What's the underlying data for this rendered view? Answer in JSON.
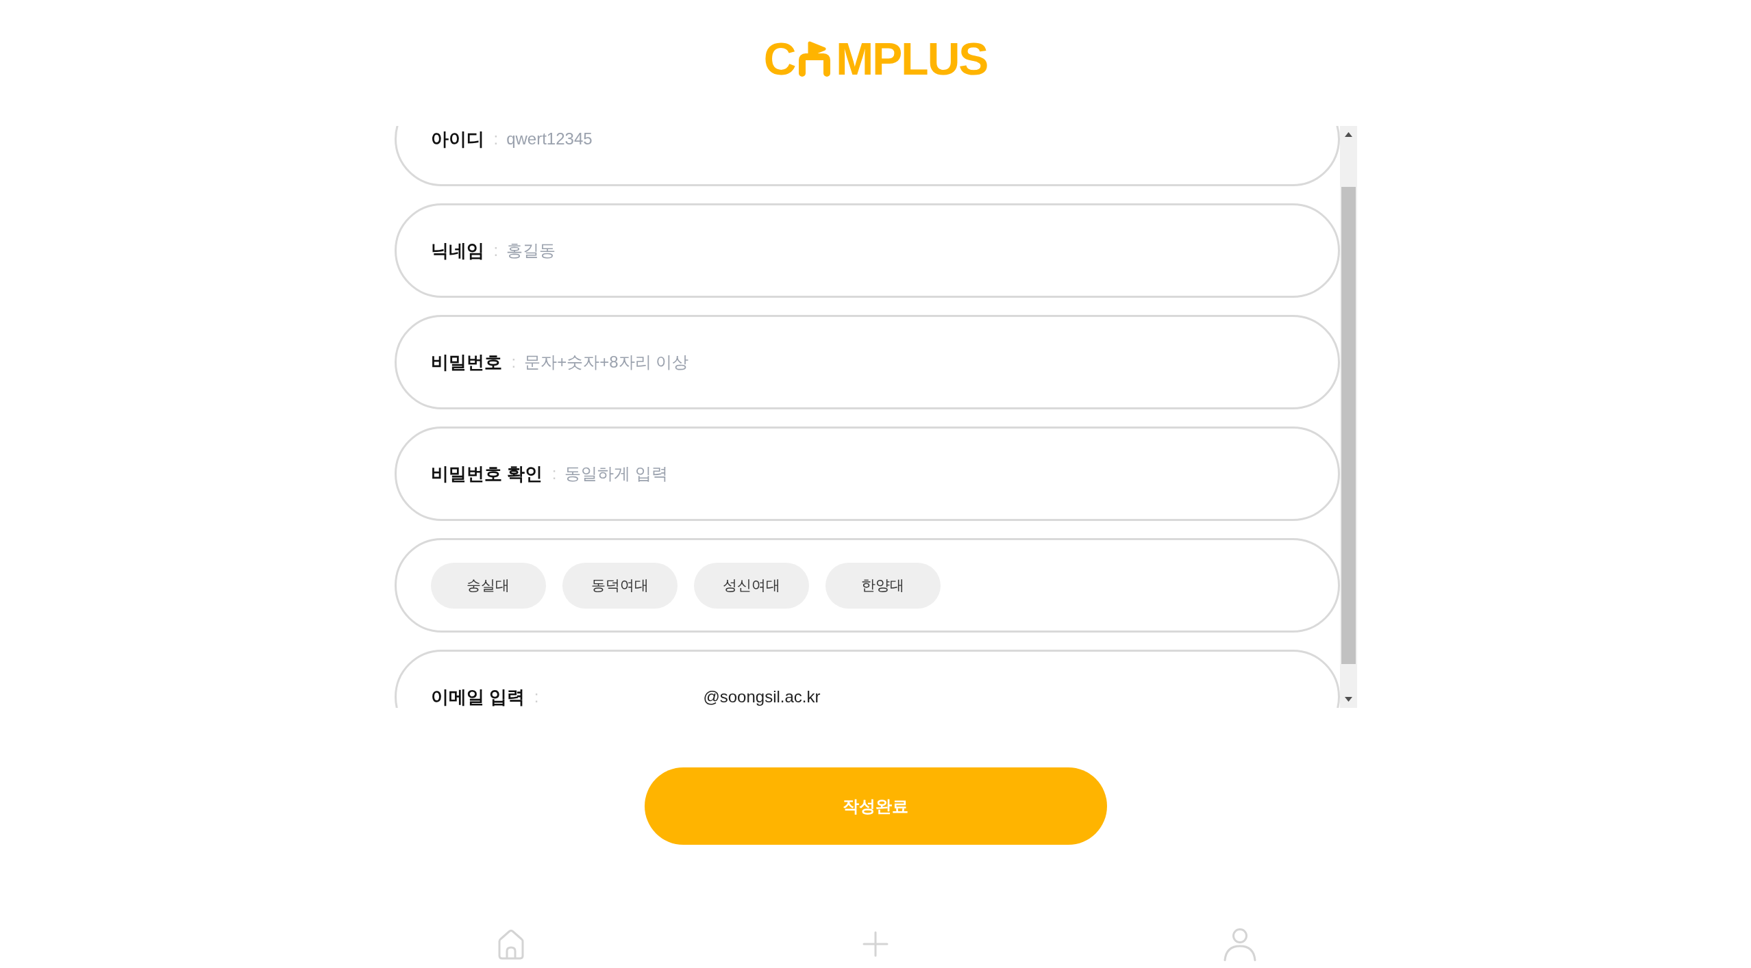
{
  "logo": {
    "lead": "C",
    "tail": "MPLUS"
  },
  "form": {
    "fields": [
      {
        "kind": "text",
        "label": "아이디",
        "separator": ":",
        "placeholder": "qwert12345"
      },
      {
        "kind": "text",
        "label": "닉네임",
        "separator": ":",
        "placeholder": "홍길동"
      },
      {
        "kind": "text",
        "label": "비밀번호",
        "separator": ":",
        "placeholder": "문자+숫자+8자리 이상"
      },
      {
        "kind": "text",
        "label": "비밀번호 확인",
        "separator": ":",
        "placeholder": "동일하게 입력"
      },
      {
        "kind": "choices",
        "options": [
          {
            "label": "숭실대",
            "selected": false
          },
          {
            "label": "동덕여대",
            "selected": false
          },
          {
            "label": "성신여대",
            "selected": false
          },
          {
            "label": "한양대",
            "selected": false
          }
        ]
      },
      {
        "kind": "email",
        "label": "이메일 입력",
        "separator": ":",
        "suffix": "@soongsil.ac.kr"
      }
    ]
  },
  "submit_button": {
    "label": "작성완료"
  }
}
